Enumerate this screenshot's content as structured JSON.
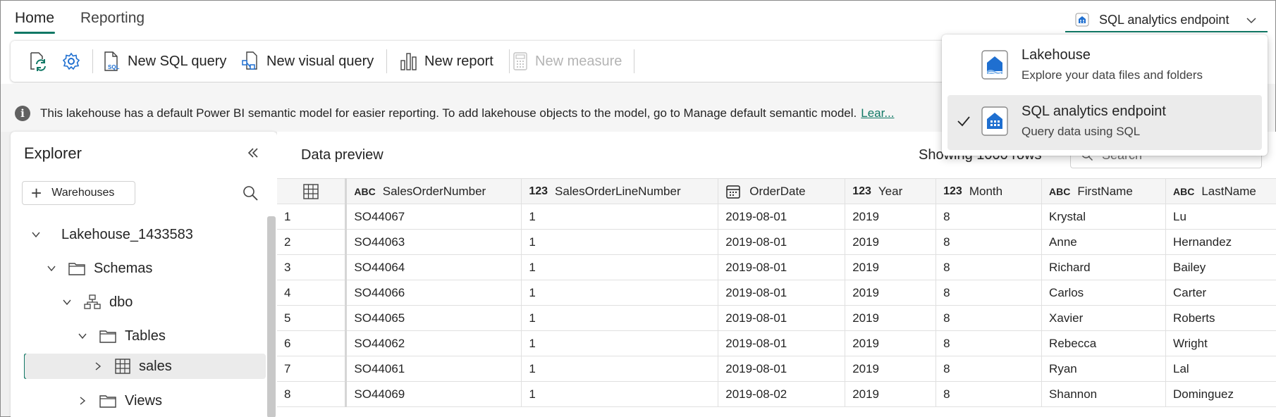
{
  "tabs": {
    "home": "Home",
    "reporting": "Reporting"
  },
  "mode_select": {
    "value": "SQL analytics endpoint",
    "icon": "sql-endpoint-icon"
  },
  "toolbar": {
    "refresh_icon": "refresh-icon",
    "settings_icon": "gear-icon",
    "new_sql_query": "New SQL query",
    "new_visual_query": "New visual query",
    "new_report": "New report",
    "new_measure": "New measure"
  },
  "info": {
    "text": "This lakehouse has a default Power BI semantic model for easier reporting. To add lakehouse objects to the model, go to Manage default semantic model.",
    "link": "Lear..."
  },
  "explorer": {
    "title": "Explorer",
    "add_button": "Warehouses",
    "tree": {
      "lakehouse": "Lakehouse_1433583",
      "schemas": "Schemas",
      "dbo": "dbo",
      "tables": "Tables",
      "sales": "sales",
      "views": "Views"
    }
  },
  "preview": {
    "title": "Data preview",
    "showing": "Showing 1000 rows",
    "search_placeholder": "Search",
    "columns": [
      {
        "type": "ABC",
        "name": "SalesOrderNumber"
      },
      {
        "type": "123",
        "name": "SalesOrderLineNumber"
      },
      {
        "type": "calendar",
        "name": "OrderDate"
      },
      {
        "type": "123",
        "name": "Year"
      },
      {
        "type": "123",
        "name": "Month"
      },
      {
        "type": "ABC",
        "name": "FirstName"
      },
      {
        "type": "ABC",
        "name": "LastName"
      }
    ],
    "rows": [
      [
        "1",
        "SO44067",
        "1",
        "2019-08-01",
        "2019",
        "8",
        "Krystal",
        "Lu"
      ],
      [
        "2",
        "SO44063",
        "1",
        "2019-08-01",
        "2019",
        "8",
        "Anne",
        "Hernandez"
      ],
      [
        "3",
        "SO44064",
        "1",
        "2019-08-01",
        "2019",
        "8",
        "Richard",
        "Bailey"
      ],
      [
        "4",
        "SO44066",
        "1",
        "2019-08-01",
        "2019",
        "8",
        "Carlos",
        "Carter"
      ],
      [
        "5",
        "SO44065",
        "1",
        "2019-08-01",
        "2019",
        "8",
        "Xavier",
        "Roberts"
      ],
      [
        "6",
        "SO44062",
        "1",
        "2019-08-01",
        "2019",
        "8",
        "Rebecca",
        "Wright"
      ],
      [
        "7",
        "SO44061",
        "1",
        "2019-08-01",
        "2019",
        "8",
        "Ryan",
        "Lal"
      ],
      [
        "8",
        "SO44069",
        "1",
        "2019-08-02",
        "2019",
        "8",
        "Shannon",
        "Dominguez"
      ]
    ]
  },
  "popup": {
    "items": [
      {
        "title": "Lakehouse",
        "subtitle": "Explore your data files and folders",
        "selected": false,
        "icon": "lakehouse-icon"
      },
      {
        "title": "SQL analytics endpoint",
        "subtitle": "Query data using SQL",
        "selected": true,
        "icon": "sql-endpoint-icon"
      }
    ]
  },
  "colors": {
    "accent": "#117865",
    "brand_blue": "#1f6fd0"
  }
}
